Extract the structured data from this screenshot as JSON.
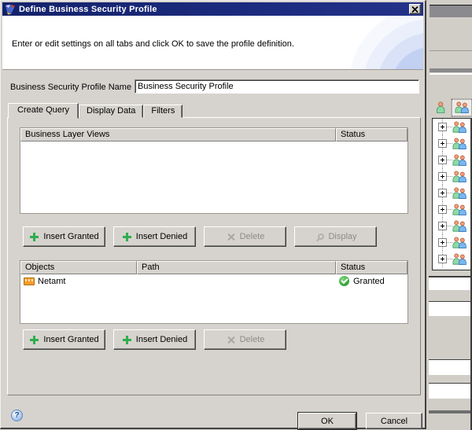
{
  "window": {
    "title": "Define Business Security Profile"
  },
  "dialog": {
    "description": "Enter or edit settings on all tabs and click OK to save the profile definition.",
    "name_field": {
      "label": "Business Security Profile Name",
      "value": "Business Security Profile"
    },
    "tabs": [
      {
        "label": "Create Query",
        "state": "active"
      },
      {
        "label": "Display Data",
        "state": "inactive"
      },
      {
        "label": "Filters",
        "state": "inactive"
      }
    ],
    "views_section": {
      "columns": [
        "Business Layer Views",
        "Status"
      ],
      "rows": [],
      "buttons": [
        {
          "label": "Insert Granted",
          "icon": "plus",
          "state": "enabled"
        },
        {
          "label": "Insert Denied",
          "icon": "plus",
          "state": "enabled"
        },
        {
          "label": "Delete",
          "icon": "x",
          "state": "disabled"
        },
        {
          "label": "Display",
          "icon": "display",
          "state": "disabled"
        }
      ]
    },
    "objects_section": {
      "columns": [
        "Objects",
        "Path",
        "Status"
      ],
      "rows": [
        {
          "name": "Netamt",
          "icon": "measure",
          "path": "",
          "status": "Granted",
          "status_icon": "granted"
        }
      ],
      "buttons": [
        {
          "label": "Insert Granted",
          "icon": "plus",
          "state": "enabled"
        },
        {
          "label": "Insert Denied",
          "icon": "plus",
          "state": "enabled"
        },
        {
          "label": "Delete",
          "icon": "x",
          "state": "disabled"
        }
      ]
    },
    "footer": {
      "ok": "OK",
      "cancel": "Cancel"
    }
  },
  "background_window": {
    "toolbar": [
      {
        "icon": "user"
      },
      {
        "icon": "user-group",
        "selected": true
      }
    ],
    "tree_rows": [
      {
        "icon": "user-group"
      },
      {
        "icon": "user-group"
      },
      {
        "icon": "user-group"
      },
      {
        "icon": "user-group"
      },
      {
        "icon": "user-group"
      },
      {
        "icon": "user-group"
      },
      {
        "icon": "user-group"
      },
      {
        "icon": "user-group"
      },
      {
        "icon": "user-group"
      }
    ]
  },
  "colors": {
    "titlebar_navy": "#1c2b7e",
    "dialog_face": "#d6d3ce",
    "insert_plus_green": "#2fae4e",
    "granted_green": "#2f9e36",
    "measure_orange": "#f59d2b"
  }
}
